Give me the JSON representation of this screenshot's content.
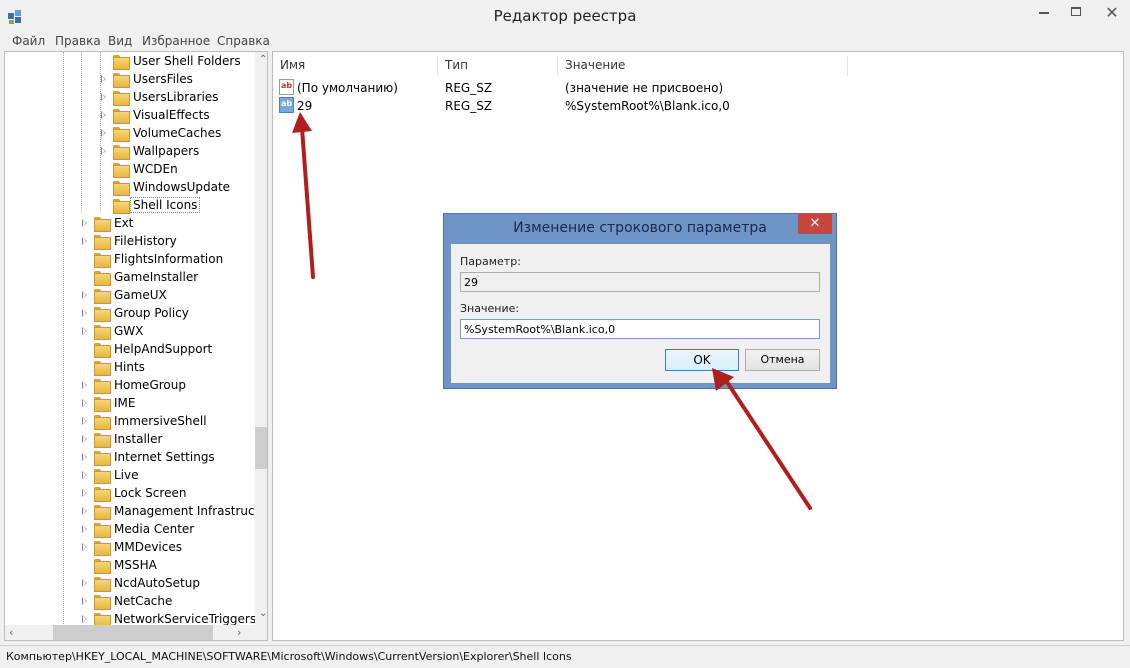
{
  "window": {
    "title": "Редактор реестра"
  },
  "menu": [
    "Файл",
    "Правка",
    "Вид",
    "Избранное",
    "Справка"
  ],
  "tree": {
    "items": [
      {
        "label": "User Shell Folders",
        "level": 2,
        "expandable": false
      },
      {
        "label": "UsersFiles",
        "level": 2,
        "expandable": true
      },
      {
        "label": "UsersLibraries",
        "level": 2,
        "expandable": true
      },
      {
        "label": "VisualEffects",
        "level": 2,
        "expandable": true
      },
      {
        "label": "VolumeCaches",
        "level": 2,
        "expandable": true
      },
      {
        "label": "Wallpapers",
        "level": 2,
        "expandable": true
      },
      {
        "label": "WCDEn",
        "level": 2,
        "expandable": false
      },
      {
        "label": "WindowsUpdate",
        "level": 2,
        "expandable": false
      },
      {
        "label": "Shell Icons",
        "level": 2,
        "expandable": false,
        "selected": true
      },
      {
        "label": "Ext",
        "level": 1,
        "expandable": true
      },
      {
        "label": "FileHistory",
        "level": 1,
        "expandable": true
      },
      {
        "label": "FlightsInformation",
        "level": 1,
        "expandable": false
      },
      {
        "label": "GameInstaller",
        "level": 1,
        "expandable": false
      },
      {
        "label": "GameUX",
        "level": 1,
        "expandable": true
      },
      {
        "label": "Group Policy",
        "level": 1,
        "expandable": true
      },
      {
        "label": "GWX",
        "level": 1,
        "expandable": true
      },
      {
        "label": "HelpAndSupport",
        "level": 1,
        "expandable": false
      },
      {
        "label": "Hints",
        "level": 1,
        "expandable": false
      },
      {
        "label": "HomeGroup",
        "level": 1,
        "expandable": true
      },
      {
        "label": "IME",
        "level": 1,
        "expandable": true
      },
      {
        "label": "ImmersiveShell",
        "level": 1,
        "expandable": true
      },
      {
        "label": "Installer",
        "level": 1,
        "expandable": true
      },
      {
        "label": "Internet Settings",
        "level": 1,
        "expandable": true
      },
      {
        "label": "Live",
        "level": 1,
        "expandable": true
      },
      {
        "label": "Lock Screen",
        "level": 1,
        "expandable": true
      },
      {
        "label": "Management Infrastructu",
        "level": 1,
        "expandable": true
      },
      {
        "label": "Media Center",
        "level": 1,
        "expandable": true
      },
      {
        "label": "MMDevices",
        "level": 1,
        "expandable": true
      },
      {
        "label": "MSSHA",
        "level": 1,
        "expandable": false
      },
      {
        "label": "NcdAutoSetup",
        "level": 1,
        "expandable": true
      },
      {
        "label": "NetCache",
        "level": 1,
        "expandable": true
      },
      {
        "label": "NetworkServiceTriggers",
        "level": 1,
        "expandable": true
      }
    ]
  },
  "list": {
    "columns": [
      "Имя",
      "Тип",
      "Значение"
    ],
    "rows": [
      {
        "name": "(По умолчанию)",
        "type": "REG_SZ",
        "value": "(значение не присвоено)"
      },
      {
        "name": "29",
        "type": "REG_SZ",
        "value": "%SystemRoot%\\Blank.ico,0"
      }
    ]
  },
  "dialog": {
    "title": "Изменение строкового параметра",
    "param_label": "Параметр:",
    "param_value": "29",
    "value_label": "Значение:",
    "value_value": "%SystemRoot%\\Blank.ico,0",
    "ok_label": "OK",
    "cancel_label": "Отмена"
  },
  "status": {
    "path": "Компьютер\\HKEY_LOCAL_MACHINE\\SOFTWARE\\Microsoft\\Windows\\CurrentVersion\\Explorer\\Shell Icons"
  },
  "colors": {
    "annotation_arrow": "#b01e1e",
    "dialog_frame": "#6f94c8",
    "close_red": "#c9463d"
  }
}
